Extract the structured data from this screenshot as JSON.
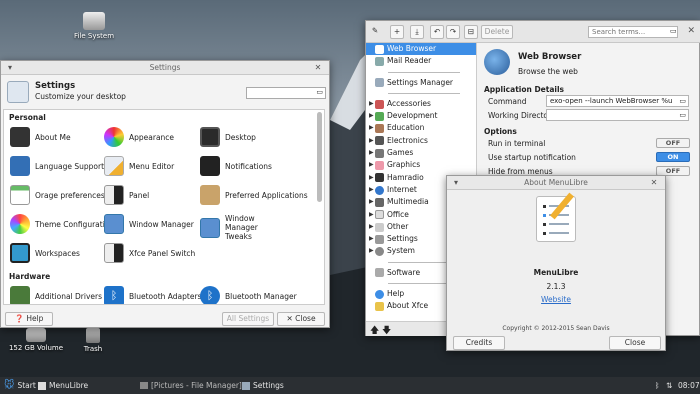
{
  "desktop": {
    "icons": [
      {
        "label": "File System"
      },
      {
        "label": "152 GB Volume"
      },
      {
        "label": "Trash"
      }
    ]
  },
  "settings": {
    "window_title": "Settings",
    "header_title": "Settings",
    "header_subtitle": "Customize your desktop",
    "search_placeholder": "",
    "sections": [
      {
        "title": "Personal",
        "items": [
          "About Me",
          "Appearance",
          "Desktop",
          "Language Support",
          "Menu Editor",
          "Notifications",
          "Orage preferences",
          "Panel",
          "Preferred Applications",
          "Theme Configuration",
          "Window Manager",
          "Window Manager Tweaks",
          "Workspaces",
          "Xfce Panel Switch"
        ]
      },
      {
        "title": "Hardware",
        "items": [
          "Additional Drivers",
          "Bluetooth Adapters",
          "Bluetooth Manager"
        ]
      }
    ],
    "help_label": "Help",
    "all_settings_label": "All Settings",
    "close_label": "Close"
  },
  "menulibre": {
    "toolbar": {
      "delete_label": "Delete",
      "search_placeholder": "Search terms..."
    },
    "tree": [
      "Web Browser",
      "Mail Reader",
      "Settings Manager",
      "Accessories",
      "Development",
      "Education",
      "Electronics",
      "Games",
      "Graphics",
      "Hamradio",
      "Internet",
      "Multimedia",
      "Office",
      "Other",
      "Settings",
      "System",
      "Software",
      "Help",
      "About Xfce"
    ],
    "app": {
      "name": "Web Browser",
      "comment": "Browse the web",
      "details_heading": "Application Details",
      "command_label": "Command",
      "command_value": "exo-open --launch WebBrowser %u",
      "workdir_label": "Working Directory",
      "workdir_value": "",
      "options_heading": "Options",
      "options": [
        {
          "label": "Run in terminal",
          "state": "OFF"
        },
        {
          "label": "Use startup notification",
          "state": "ON"
        },
        {
          "label": "Hide from menus",
          "state": "OFF"
        }
      ]
    }
  },
  "about": {
    "title": "About MenuLibre",
    "name": "MenuLibre",
    "version": "2.1.3",
    "website_label": "Website",
    "copyright": "Copyright © 2012-2015 Sean Davis",
    "credits_label": "Credits",
    "close_label": "Close"
  },
  "panel": {
    "start_label": "Start",
    "tasks": [
      "MenuLibre",
      "[Pictures - File Manager]",
      "Settings"
    ],
    "clock": "08:07"
  },
  "colors": {
    "accent": "#3d8ee6",
    "panel": "#2b2f33"
  }
}
